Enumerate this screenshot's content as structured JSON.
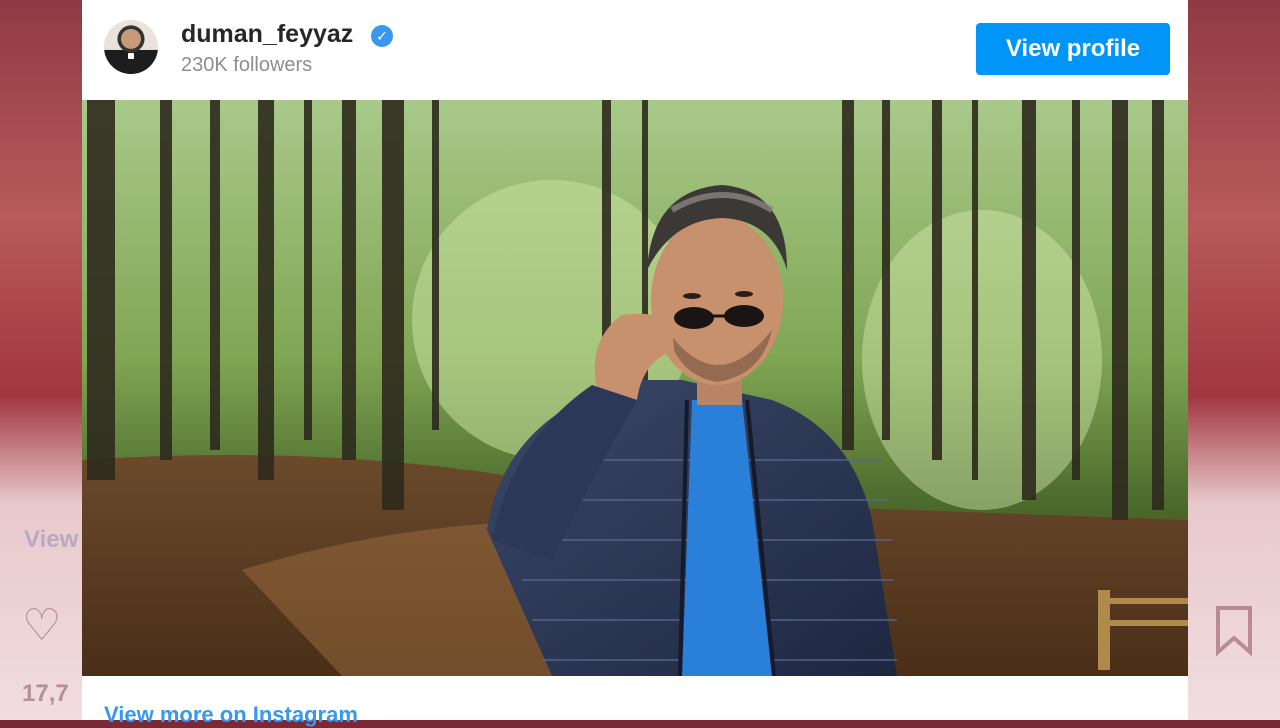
{
  "background": {
    "left_ghost_link": "View",
    "left_ghost_count": "17,7",
    "icons": [
      "heart-icon",
      "bookmark-icon"
    ]
  },
  "profile": {
    "username": "duman_feyyaz",
    "followers": "230K followers",
    "verified_icon": "verified-badge-icon",
    "view_profile_label": "View profile"
  },
  "post": {
    "image": "man-in-forest-photo"
  },
  "footer": {
    "view_more_label": "View more on Instagram"
  },
  "colors": {
    "accent": "#0095f6",
    "link": "#3897f0",
    "username": "#262626",
    "muted": "#8e8e8e"
  }
}
